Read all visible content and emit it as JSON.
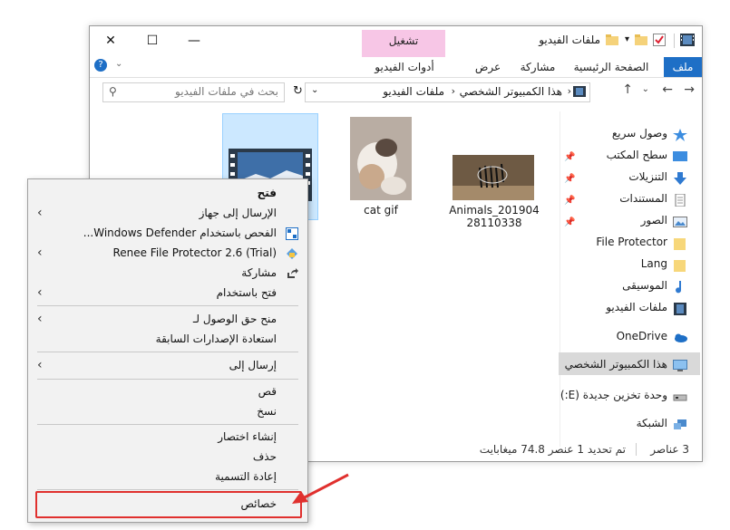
{
  "window": {
    "title": "ملفات الفيديو",
    "play_tab": "تشغيل",
    "close_glyph": "✕",
    "max_glyph": "☐",
    "min_glyph": "—"
  },
  "ribbon": {
    "file": "ملف",
    "home": "الصفحة الرئيسية",
    "share": "مشاركة",
    "view": "عرض",
    "video_tools": "أدوات الفيديو"
  },
  "address": {
    "path_root": "هذا الكمبيوتر الشخصي",
    "path_sep": "›",
    "path_folder": "ملفات الفيديو",
    "search_placeholder": "بحث في ملفات الفيديو"
  },
  "nav": {
    "quick_access": "وصول سريع",
    "items": [
      {
        "label": "سطح المكتب",
        "pinned": true
      },
      {
        "label": "التنزيلات",
        "pinned": true
      },
      {
        "label": "المستندات",
        "pinned": true
      },
      {
        "label": "الصور",
        "pinned": true
      },
      {
        "label": "File Protector",
        "pinned": false
      },
      {
        "label": "Lang",
        "pinned": false
      },
      {
        "label": "الموسيقى",
        "pinned": false
      },
      {
        "label": "ملفات الفيديو",
        "pinned": false
      }
    ],
    "onedrive": "OneDrive",
    "this_pc": "هذا الكمبيوتر الشخصي",
    "drive": "وحدة تخزين جديدة (E:)",
    "network": "الشبكة"
  },
  "files": [
    {
      "name": "Animals_20190428110338"
    },
    {
      "name": "cat gif"
    }
  ],
  "status": {
    "count": "3 عناصر",
    "selection": "تم تحديد 1 عنصر 74.8 ميغابايت"
  },
  "context_menu": {
    "open": "فتح",
    "send_to_device": "الإرسال إلى جهاز",
    "defender": "الفحص باستخدام Windows Defender...",
    "renee": "Renee File Protector 2.6 (Trial)",
    "share": "مشاركة",
    "open_with": "فتح باستخدام",
    "give_access": "منح حق الوصول لـ",
    "restore": "استعادة الإصدارات السابقة",
    "send_to": "إرسال إلى",
    "cut": "قص",
    "copy": "نسخ",
    "create_shortcut": "إنشاء اختصار",
    "delete": "حذف",
    "rename": "إعادة التسمية",
    "properties": "خصائص"
  },
  "colors": {
    "accent": "#1e6fc6",
    "highlight_box": "#e0302e",
    "play_tab": "#f7c6e6",
    "selection": "#cce8ff"
  }
}
